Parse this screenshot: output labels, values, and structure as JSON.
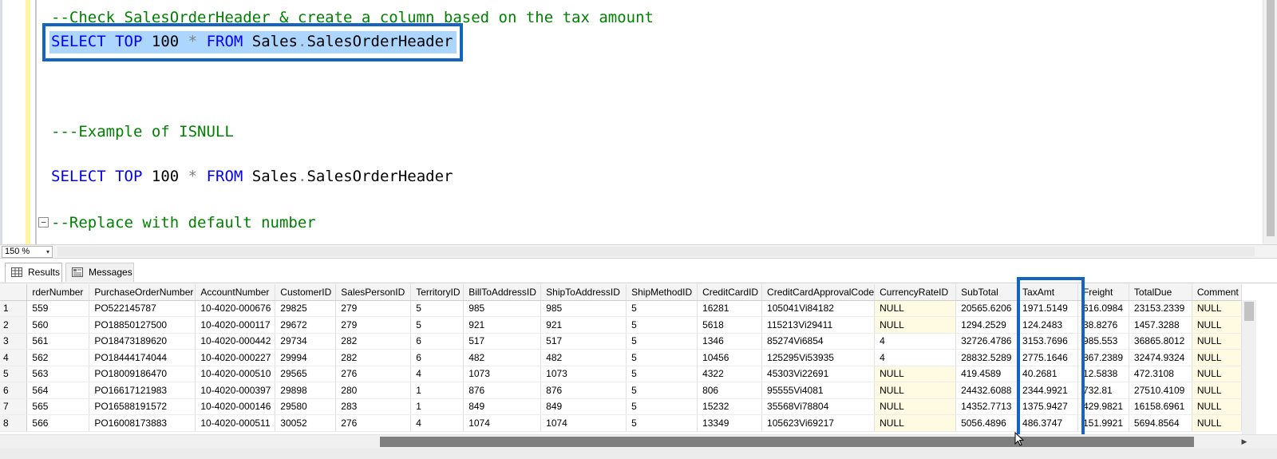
{
  "editor": {
    "lines": [
      {
        "comment": "--Check SalesOrderHeader & create a column based on the tax amount"
      },
      {
        "kw1": "SELECT",
        "kw2": "TOP",
        "num": "100",
        "op": "*",
        "kw3": "FROM",
        "obj": "Sales",
        "dot": ".",
        "tbl": "SalesOrderHeader"
      },
      {
        "comment": "---Example of ISNULL"
      },
      {
        "kw1": "SELECT",
        "kw2": "TOP",
        "num": "100",
        "op": "*",
        "kw3": "FROM",
        "obj": "Sales",
        "dot": ".",
        "tbl": "SalesOrderHeader"
      },
      {
        "comment": "--Replace with default number"
      }
    ],
    "collapse_glyph": "−"
  },
  "zoom": {
    "value": "150 %",
    "arrow": "▾"
  },
  "tabs": {
    "results": "Results",
    "messages": "Messages"
  },
  "grid": {
    "columns": [
      "rderNumber",
      "PurchaseOrderNumber",
      "AccountNumber",
      "CustomerID",
      "SalesPersonID",
      "TerritoryID",
      "BillToAddressID",
      "ShipToAddressID",
      "ShipMethodID",
      "CreditCardID",
      "CreditCardApprovalCode",
      "CurrencyRateID",
      "SubTotal",
      "TaxAmt",
      "Freight",
      "TotalDue",
      "Comment"
    ],
    "rows": [
      {
        "n": "1",
        "cells": [
          "559",
          "PO522145787",
          "10-4020-000676",
          "29825",
          "279",
          "5",
          "985",
          "985",
          "5",
          "16281",
          "105041Vi84182",
          "NULL",
          "20565.6206",
          "1971.5149",
          "616.0984",
          "23153.2339",
          "NULL"
        ]
      },
      {
        "n": "2",
        "cells": [
          "560",
          "PO18850127500",
          "10-4020-000117",
          "29672",
          "279",
          "5",
          "921",
          "921",
          "5",
          "5618",
          "115213Vi29411",
          "NULL",
          "1294.2529",
          "124.2483",
          "38.8276",
          "1457.3288",
          "NULL"
        ]
      },
      {
        "n": "3",
        "cells": [
          "561",
          "PO18473189620",
          "10-4020-000442",
          "29734",
          "282",
          "6",
          "517",
          "517",
          "5",
          "1346",
          "85274Vi6854",
          "4",
          "32726.4786",
          "3153.7696",
          "985.553",
          "36865.8012",
          "NULL"
        ]
      },
      {
        "n": "4",
        "cells": [
          "562",
          "PO18444174044",
          "10-4020-000227",
          "29994",
          "282",
          "6",
          "482",
          "482",
          "5",
          "10456",
          "125295Vi53935",
          "4",
          "28832.5289",
          "2775.1646",
          "867.2389",
          "32474.9324",
          "NULL"
        ]
      },
      {
        "n": "5",
        "cells": [
          "563",
          "PO18009186470",
          "10-4020-000510",
          "29565",
          "276",
          "4",
          "1073",
          "1073",
          "5",
          "4322",
          "45303Vi22691",
          "NULL",
          "419.4589",
          "40.2681",
          "12.5838",
          "472.3108",
          "NULL"
        ]
      },
      {
        "n": "6",
        "cells": [
          "564",
          "PO16617121983",
          "10-4020-000397",
          "29898",
          "280",
          "1",
          "876",
          "876",
          "5",
          "806",
          "95555Vi4081",
          "NULL",
          "24432.6088",
          "2344.9921",
          "732.81",
          "27510.4109",
          "NULL"
        ]
      },
      {
        "n": "7",
        "cells": [
          "565",
          "PO16588191572",
          "10-4020-000146",
          "29580",
          "283",
          "1",
          "849",
          "849",
          "5",
          "15232",
          "35568Vi78804",
          "NULL",
          "14352.7713",
          "1375.9427",
          "429.9821",
          "16158.6961",
          "NULL"
        ]
      },
      {
        "n": "8",
        "cells": [
          "566",
          "PO16008173883",
          "10-4020-000511",
          "30052",
          "276",
          "4",
          "1074",
          "1074",
          "5",
          "13349",
          "105623Vi69217",
          "NULL",
          "5056.4896",
          "486.3747",
          "151.9921",
          "5694.8564",
          "NULL"
        ]
      }
    ]
  },
  "colors": {
    "highlight_border": "#1565c0",
    "selection": "#add6ff",
    "comment": "#008000",
    "keyword": "#0000ff",
    "null_cell": "#fffbe3"
  }
}
